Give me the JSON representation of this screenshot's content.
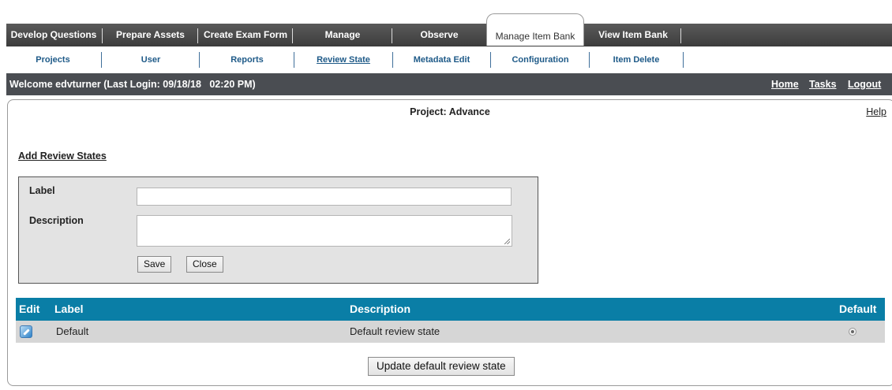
{
  "top_tabs": [
    {
      "label": "Develop Questions"
    },
    {
      "label": "Prepare Assets"
    },
    {
      "label": "Create Exam Form"
    },
    {
      "label": "Manage"
    },
    {
      "label": "Observe"
    },
    {
      "label": "Manage Item Bank",
      "active": true
    },
    {
      "label": "View Item Bank"
    }
  ],
  "sub_tabs": [
    {
      "label": "Projects"
    },
    {
      "label": "User"
    },
    {
      "label": "Reports"
    },
    {
      "label": "Review State",
      "active": true
    },
    {
      "label": "Metadata Edit"
    },
    {
      "label": "Configuration"
    },
    {
      "label": "Item Delete"
    }
  ],
  "welcome": {
    "text": "Welcome edvturner (Last Login: 09/18/18   02:20 PM)",
    "links": {
      "home": "Home",
      "tasks": "Tasks",
      "logout": "Logout"
    }
  },
  "page": {
    "project_title": "Project: Advance",
    "help": "Help",
    "add_link": "Add Review States"
  },
  "form": {
    "label_label": "Label",
    "label_value": "",
    "description_label": "Description",
    "description_value": "",
    "save": "Save",
    "close": "Close"
  },
  "table": {
    "headers": {
      "edit": "Edit",
      "label": "Label",
      "description": "Description",
      "default": "Default"
    },
    "rows": [
      {
        "label": "Default",
        "description": "Default review state",
        "is_default": true
      }
    ]
  },
  "update_button": "Update default review state",
  "colors": {
    "header_bar": "#3c3c3c",
    "table_header": "#0a7ea6",
    "welcome_bar": "#4a4d52",
    "link_blue": "#1e5a88"
  }
}
